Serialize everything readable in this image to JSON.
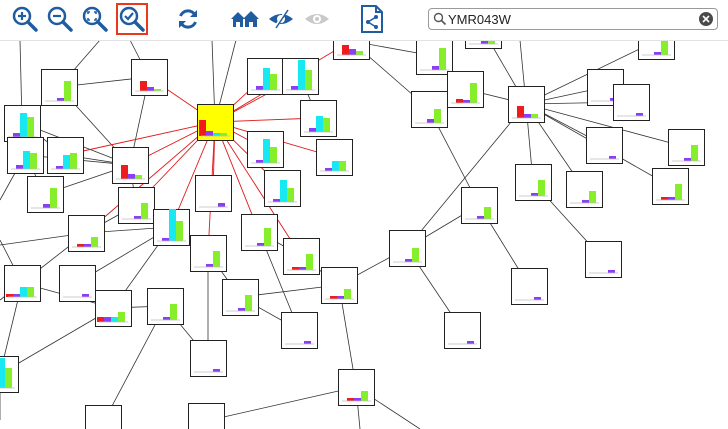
{
  "toolbar": {
    "buttons": [
      {
        "name": "zoom-in-icon",
        "active": false
      },
      {
        "name": "zoom-out-icon",
        "active": false
      },
      {
        "name": "zoom-fit-icon",
        "active": false
      },
      {
        "name": "zoom-selected-icon",
        "active": true
      },
      {
        "name": "refresh-icon",
        "active": false
      },
      {
        "name": "home-icon",
        "active": false
      },
      {
        "name": "hide-icon",
        "active": false
      },
      {
        "name": "show-icon",
        "active": false
      },
      {
        "name": "export-icon",
        "active": false
      }
    ],
    "accent": "#1f5da0",
    "active_border": "#e8391d"
  },
  "search": {
    "value": "YMR043W",
    "icon": "search-icon",
    "clear_icon": "clear-icon"
  },
  "network": {
    "colors": {
      "red": "#ee1c1c",
      "purple": "#8a3ff5",
      "cyan": "#17e8f2",
      "green": "#86ee2a",
      "selected_bg": "#ffff00",
      "edge": "#333333",
      "highlight_edge": "#e01a1a"
    },
    "selected_node": "YMR043W"
  }
}
